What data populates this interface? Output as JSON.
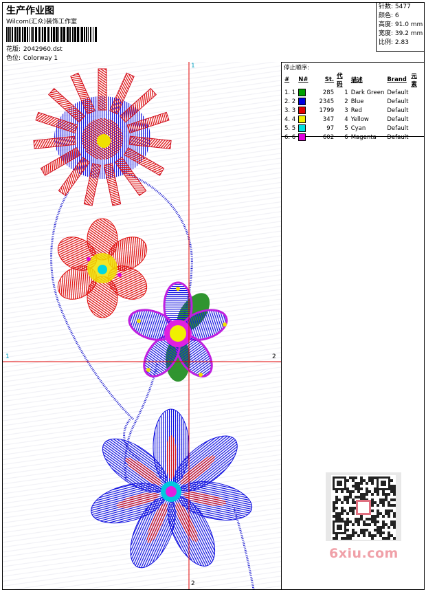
{
  "header": {
    "title": "生产作业图",
    "company": "Wilcom(汇众)装饰工作室",
    "pattern_label": "花版:",
    "pattern_value": "2042960.dst",
    "colorway_label": "色位:",
    "colorway_value": "Colorway 1"
  },
  "stats": {
    "stitches": "针数: 5477",
    "colors": "颜色: 6",
    "height": "高度: 91.0 mm",
    "width": "宽度: 39.2 mm",
    "scale": "比例: 2.83"
  },
  "sequence": {
    "caption": "停止顺序:",
    "headers": [
      "#",
      "N#",
      "St.",
      "代码",
      "描述",
      "Brand",
      "元素"
    ],
    "rows": [
      {
        "idx": "1. 1",
        "stitches": "285",
        "code": "1",
        "desc": "Dark Green",
        "brand": "Default",
        "color": "#00a000"
      },
      {
        "idx": "2. 2",
        "stitches": "2345",
        "code": "2",
        "desc": "Blue",
        "brand": "Default",
        "color": "#0000e0"
      },
      {
        "idx": "3. 3",
        "stitches": "1799",
        "code": "3",
        "desc": "Red",
        "brand": "Default",
        "color": "#e00000"
      },
      {
        "idx": "4. 4",
        "stitches": "347",
        "code": "4",
        "desc": "Yellow",
        "brand": "Default",
        "color": "#f0f000"
      },
      {
        "idx": "5. 5",
        "stitches": "97",
        "code": "5",
        "desc": "Cyan",
        "brand": "Default",
        "color": "#00e0e0"
      },
      {
        "idx": "6. 6",
        "stitches": "602",
        "code": "6",
        "desc": "Magenta",
        "brand": "Default",
        "color": "#e000e0"
      }
    ]
  },
  "axes": {
    "h_start": "1",
    "h_end": "2",
    "v_start": "1",
    "v_end": "2"
  },
  "watermark": "6xiu.com"
}
